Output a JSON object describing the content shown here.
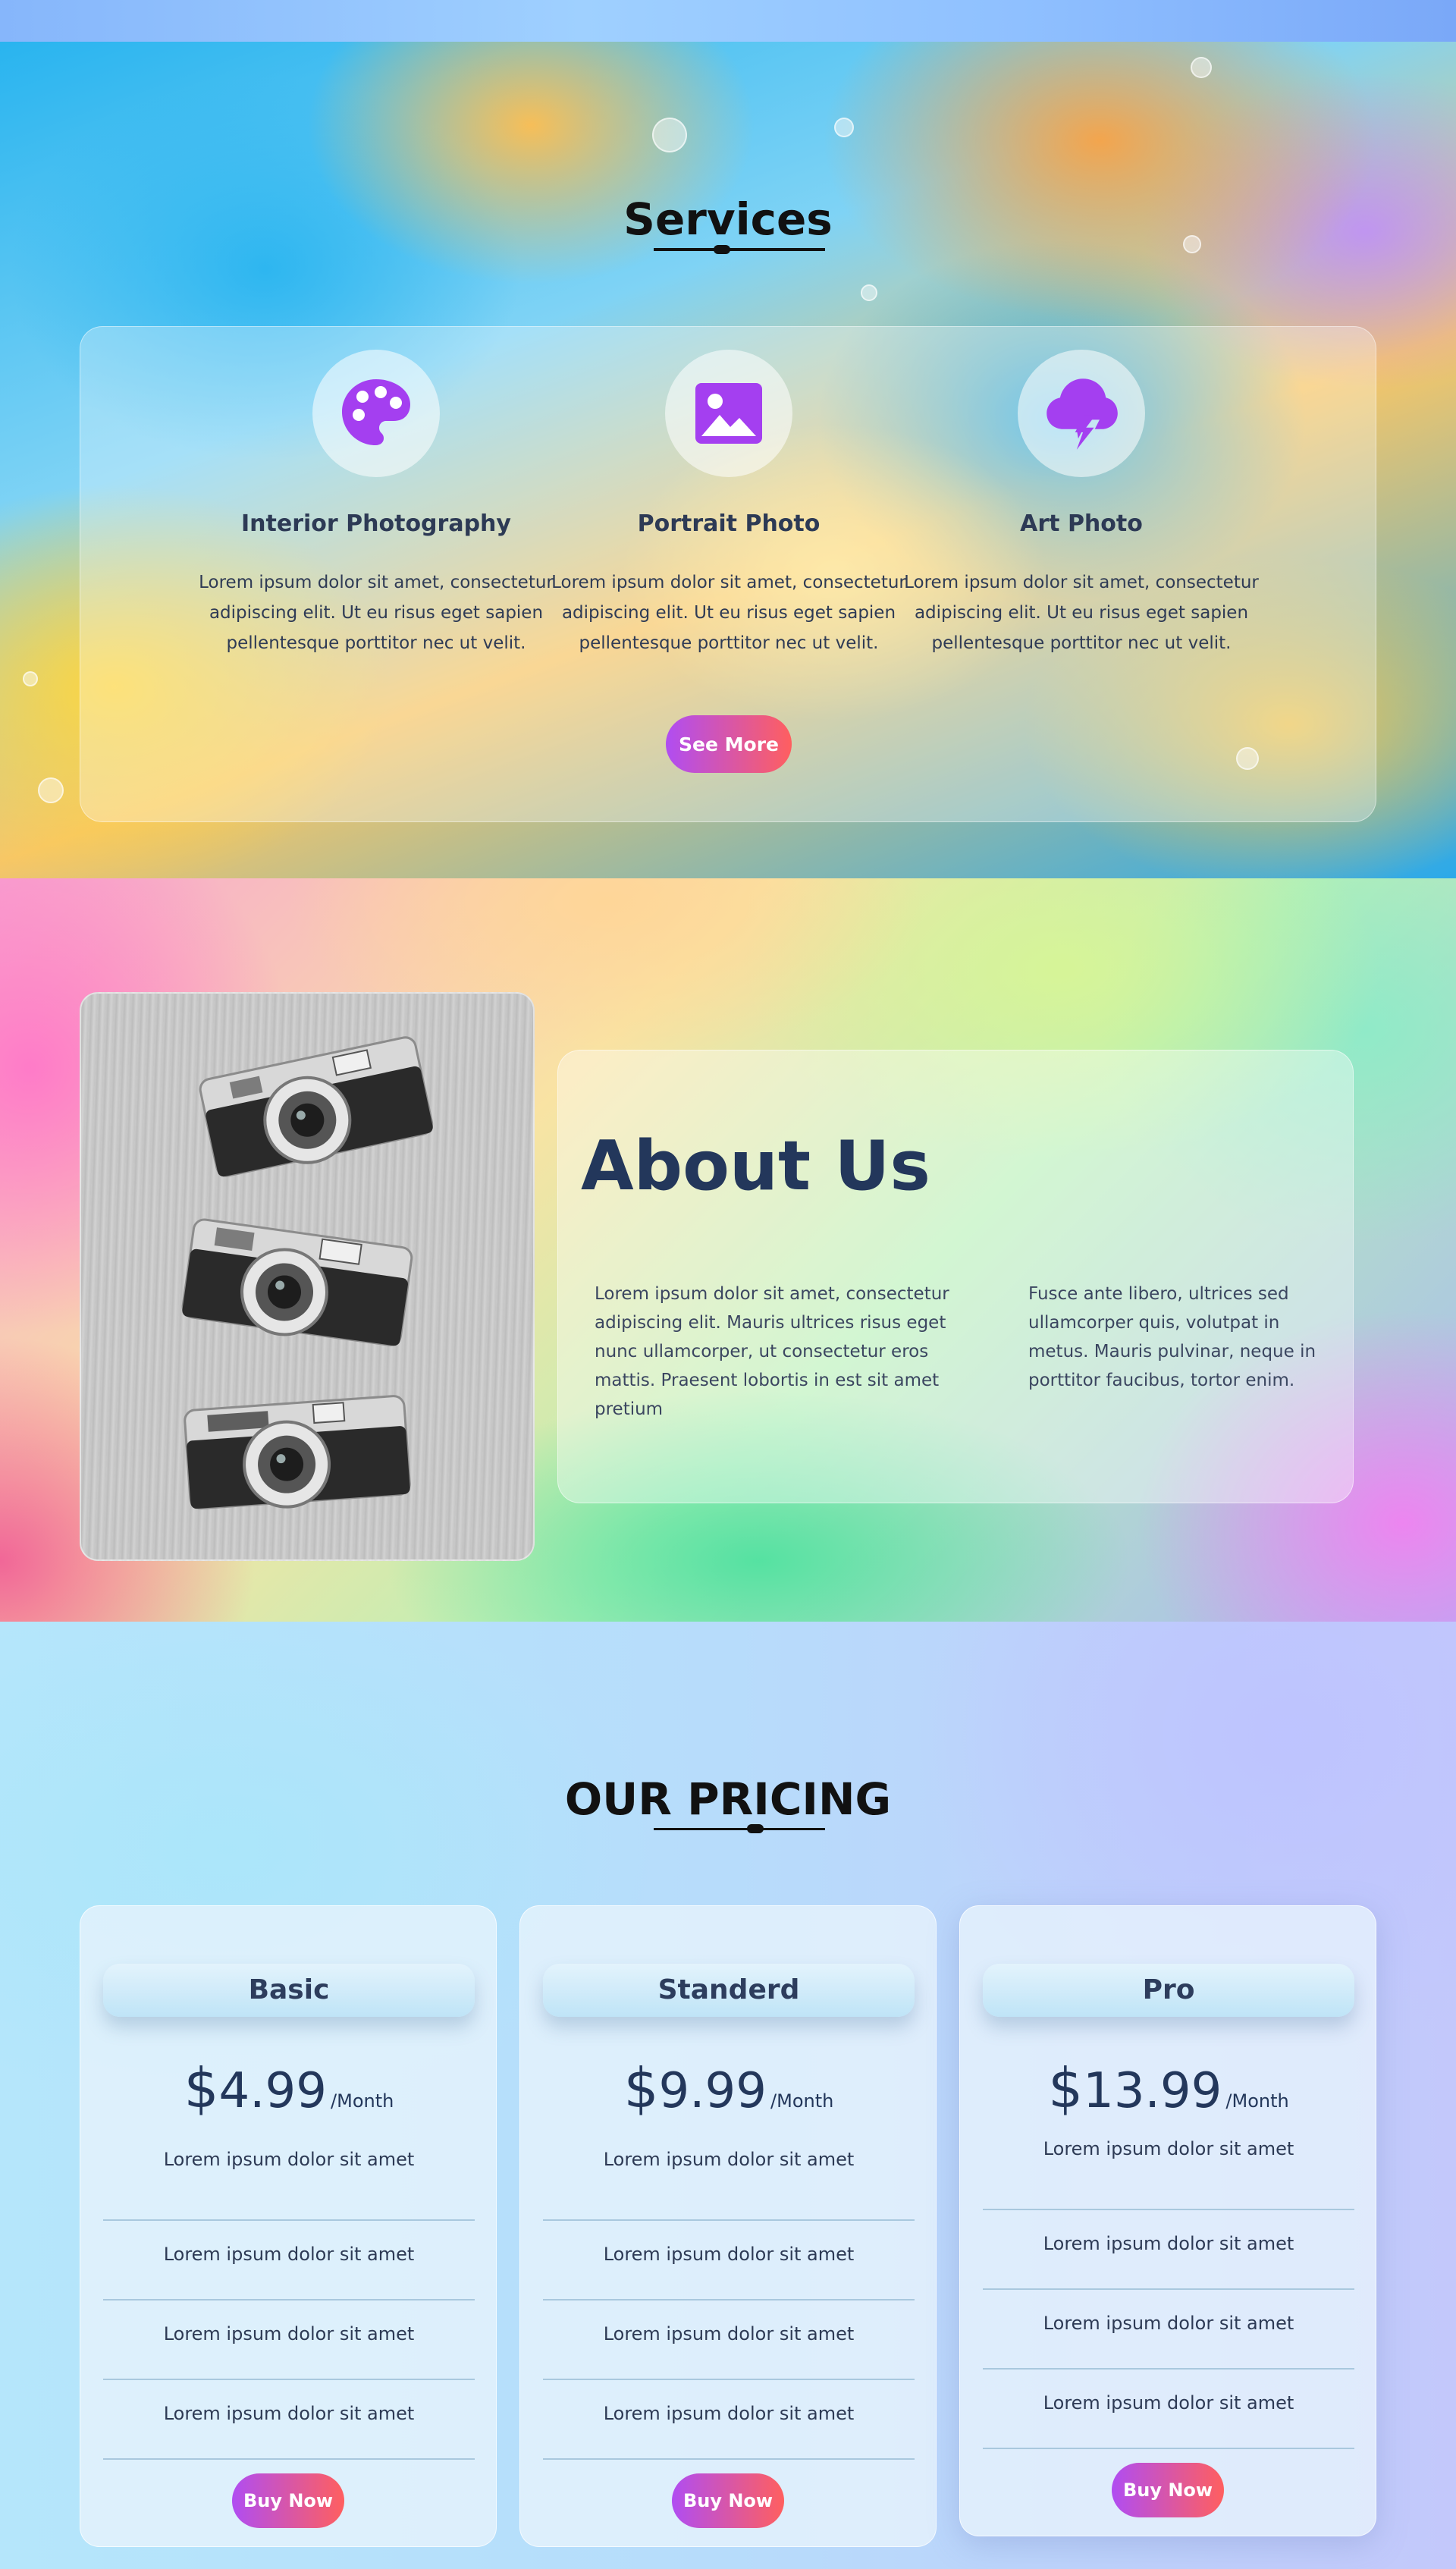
{
  "colors": {
    "accent_gradient_start": "#b04df2",
    "accent_gradient_end": "#ff5f5f",
    "icon_purple": "#a43ff0",
    "heading_navy": "#23375b"
  },
  "services": {
    "title": "Services",
    "items": [
      {
        "icon": "palette-icon",
        "title": "Interior Photography",
        "text": "Lorem ipsum dolor sit amet, consectetur adipiscing elit. Ut eu risus eget sapien pellentesque porttitor nec ut velit."
      },
      {
        "icon": "image-icon",
        "title": "Portrait Photo",
        "text": "Lorem ipsum dolor sit amet, consectetur adipiscing elit. Ut eu risus eget sapien pellentesque porttitor nec ut velit."
      },
      {
        "icon": "storm-cloud-icon",
        "title": "Art Photo",
        "text": "Lorem ipsum dolor sit amet, consectetur adipiscing elit. Ut eu risus eget sapien pellentesque porttitor nec ut velit."
      }
    ],
    "see_more_label": "See More"
  },
  "about": {
    "title": "About Us",
    "col1": "Lorem ipsum dolor sit amet, consectetur adipiscing elit. Mauris ultrices risus eget nunc ullamcorper, ut consectetur eros mattis. Praesent lobortis in est sit amet pretium",
    "col2": "Fusce ante libero, ultrices sed ullamcorper quis, volutpat in metus. Mauris pulvinar, neque in porttitor faucibus, tortor enim."
  },
  "pricing": {
    "title": "OUR PRICING",
    "plans": [
      {
        "name": "Basic",
        "currency": "$",
        "amount": "4.99",
        "period": "/Month",
        "features": [
          "Lorem ipsum dolor sit amet",
          "Lorem ipsum dolor sit amet",
          "Lorem ipsum dolor sit amet",
          "Lorem ipsum dolor sit amet"
        ],
        "button": "Buy Now"
      },
      {
        "name": "Standerd",
        "currency": "$",
        "amount": "9.99",
        "period": "/Month",
        "features": [
          "Lorem ipsum dolor sit amet",
          "Lorem ipsum dolor sit amet",
          "Lorem ipsum dolor sit amet",
          "Lorem ipsum dolor sit amet"
        ],
        "button": "Buy Now"
      },
      {
        "name": "Pro",
        "currency": "$",
        "amount": "13.99",
        "period": "/Month",
        "features": [
          "Lorem ipsum dolor sit amet",
          "Lorem ipsum dolor sit amet",
          "Lorem ipsum dolor sit amet",
          "Lorem ipsum dolor sit amet"
        ],
        "button": "Buy Now"
      }
    ]
  }
}
